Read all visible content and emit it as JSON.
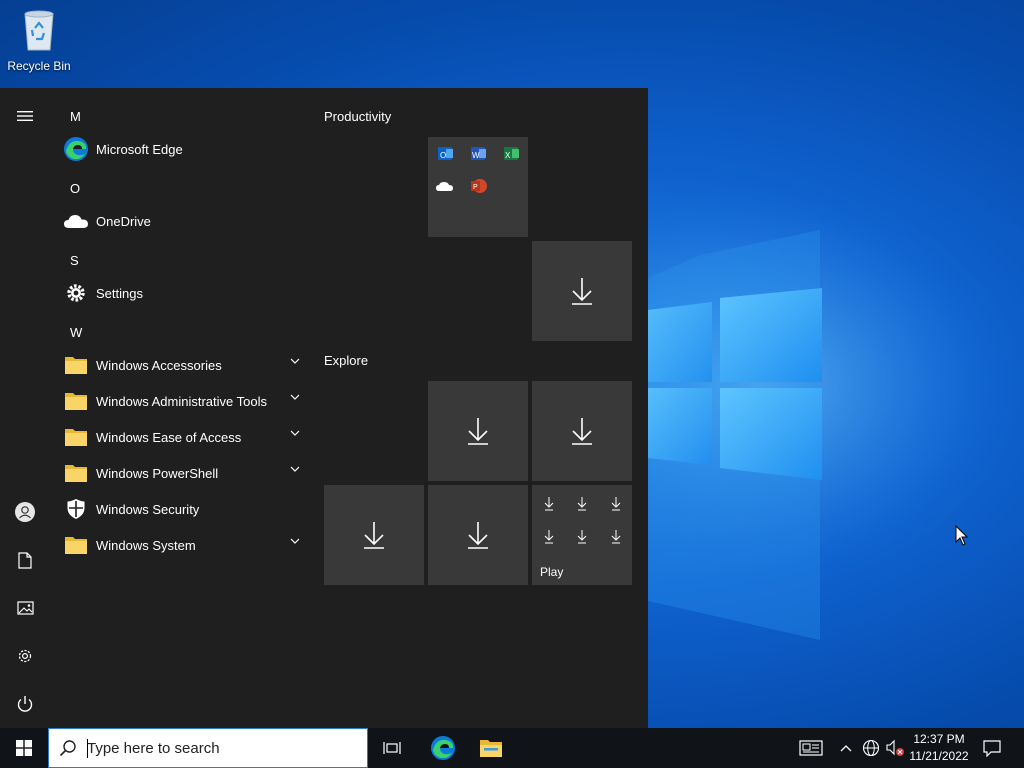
{
  "desktop": {
    "icons": [
      {
        "label": "Recycle Bin",
        "icon": "recycle-bin-icon"
      }
    ]
  },
  "start_menu": {
    "rail": [
      {
        "icon": "hamburger-menu-icon"
      },
      {
        "icon": "user-account-icon"
      },
      {
        "icon": "documents-icon"
      },
      {
        "icon": "pictures-icon"
      },
      {
        "icon": "settings-gear-icon"
      },
      {
        "icon": "power-icon"
      }
    ],
    "apps": {
      "letters": [
        "M",
        "O",
        "S",
        "W"
      ],
      "items": [
        {
          "label": "Microsoft Edge",
          "icon": "edge-icon",
          "expandable": false
        },
        {
          "label": "OneDrive",
          "icon": "onedrive-cloud-icon",
          "expandable": false
        },
        {
          "label": "Settings",
          "icon": "settings-gear-icon",
          "expandable": false
        },
        {
          "label": "Windows Accessories",
          "icon": "folder-icon",
          "expandable": true
        },
        {
          "label": "Windows Administrative Tools",
          "icon": "folder-icon",
          "expandable": true
        },
        {
          "label": "Windows Ease of Access",
          "icon": "folder-icon",
          "expandable": true
        },
        {
          "label": "Windows PowerShell",
          "icon": "folder-icon",
          "expandable": true
        },
        {
          "label": "Windows Security",
          "icon": "shield-icon",
          "expandable": false
        },
        {
          "label": "Windows System",
          "icon": "folder-icon",
          "expandable": true
        }
      ]
    },
    "tiles": {
      "groups": [
        {
          "title": "Productivity"
        },
        {
          "title": "Explore"
        }
      ],
      "productivity_office_icons": [
        "outlook-icon",
        "word-icon",
        "excel-icon",
        "onedrive-icon",
        "powerpoint-icon"
      ],
      "play_tile_label": "Play",
      "download_icon": "download-arrow-icon"
    }
  },
  "taskbar": {
    "start_icon": "windows-logo-icon",
    "search_placeholder": "Type here to search",
    "pinned": [
      "task-view-icon",
      "edge-icon",
      "file-explorer-icon"
    ],
    "tray_icons": [
      "news-and-interests-icon",
      "show-hidden-icons-chevron",
      "network-icon",
      "volume-muted-icon",
      "notifications-icon"
    ],
    "time": "12:37 PM",
    "date": "11/21/2022"
  },
  "colors": {
    "menu_bg": "#1f1f1f",
    "tile_bg": "#393939",
    "taskbar_bg": "#101419",
    "accent": "#0078d7"
  }
}
